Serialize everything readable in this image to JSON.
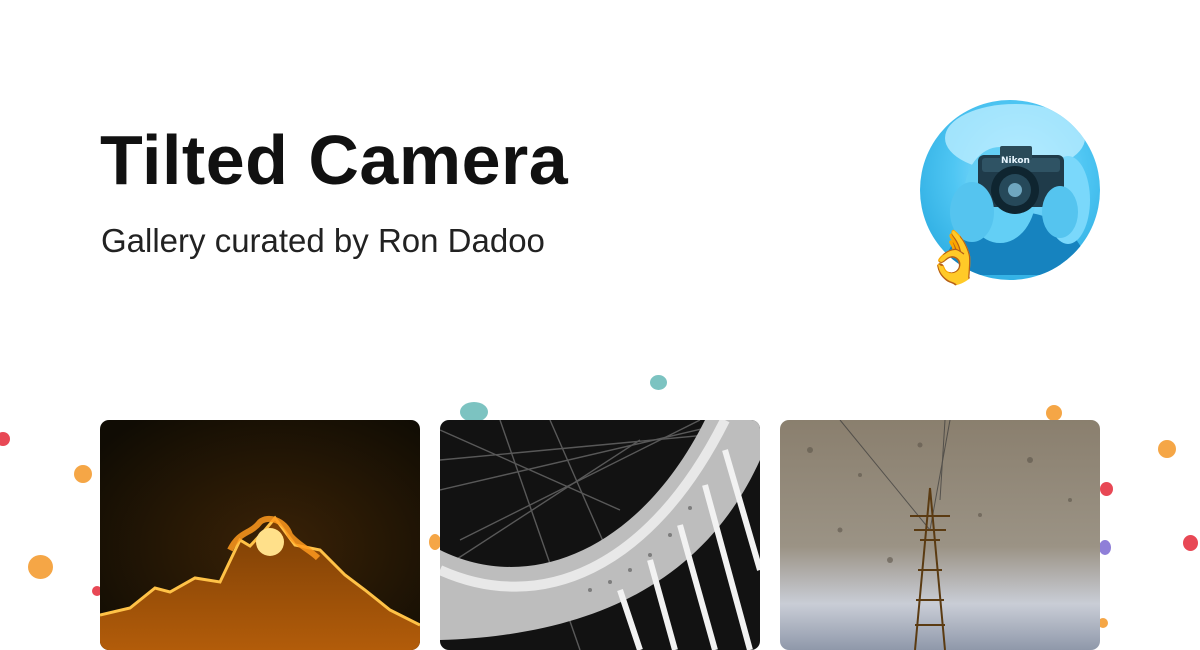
{
  "header": {
    "title": "Tilted Camera",
    "subtitle": "Gallery curated by Ron Dadoo"
  },
  "avatar": {
    "icon": "photographer-with-camera",
    "camera_brand": "Nikon",
    "badge_emoji": "👌"
  },
  "gallery": {
    "photos": [
      {
        "icon": "sunset-fire-silhouette"
      },
      {
        "icon": "steel-bridge-arch"
      },
      {
        "icon": "power-pylon-reflection"
      }
    ]
  },
  "colors": {
    "title": "#111111",
    "subtitle": "#222222",
    "background": "#ffffff",
    "confetti": [
      "#f5a646",
      "#e84855",
      "#7cc3c1",
      "#8f7fd8"
    ]
  }
}
